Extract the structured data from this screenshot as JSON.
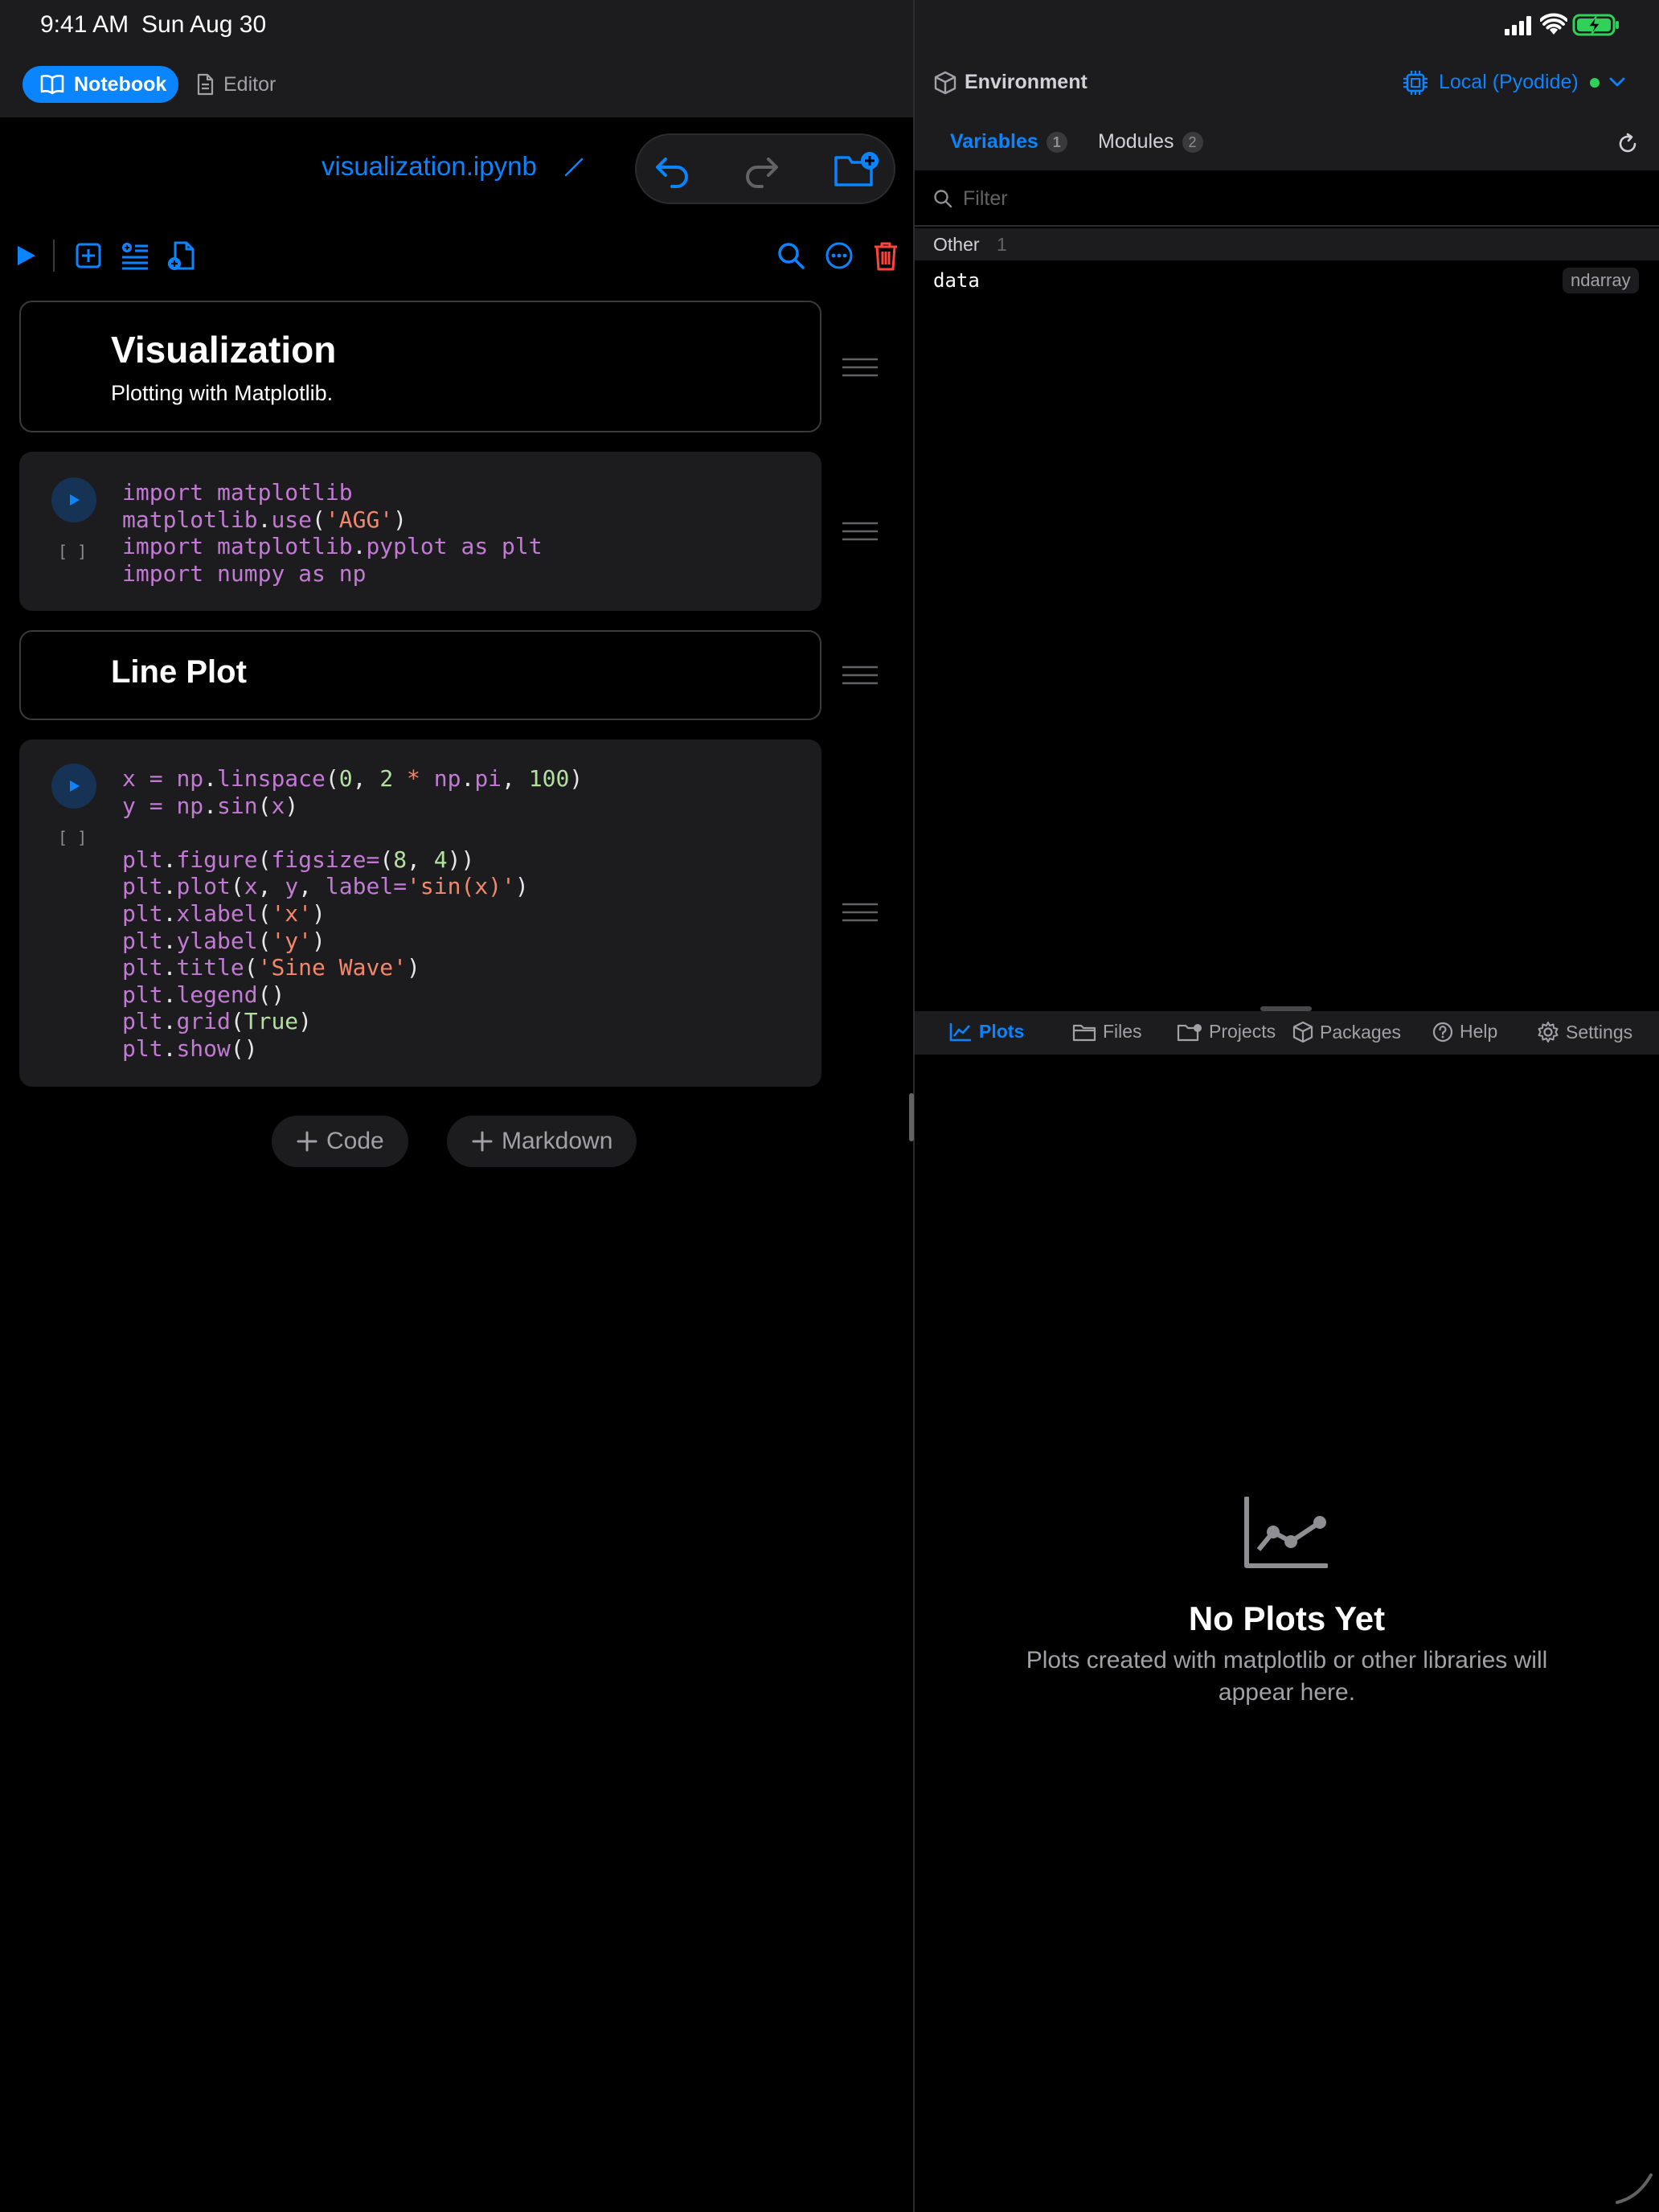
{
  "status_bar": {
    "time": "9:41 AM",
    "date": "Sun Aug 30"
  },
  "left_header": {
    "notebook_label": "Notebook",
    "editor_label": "Editor"
  },
  "notebook": {
    "filename": "visualization.ipynb"
  },
  "cells": [
    {
      "type": "markdown",
      "heading": "Visualization",
      "text": "Plotting with Matplotlib."
    },
    {
      "type": "code",
      "exec_count": "[ ]"
    },
    {
      "type": "markdown",
      "heading": "Line Plot"
    },
    {
      "type": "code",
      "exec_count": "[ ]"
    }
  ],
  "add_buttons": {
    "code": "Code",
    "markdown": "Markdown"
  },
  "environment": {
    "title": "Environment",
    "kernel": "Local (Pyodide)",
    "kernel_status_color": "#30d158",
    "tabs": [
      {
        "label": "Variables",
        "count": "1"
      },
      {
        "label": "Modules",
        "count": "2"
      }
    ],
    "filter_placeholder": "Filter",
    "group": {
      "label": "Other",
      "count": "1"
    },
    "variables": [
      {
        "name": "data",
        "type": "ndarray"
      }
    ]
  },
  "bottom_tabs": [
    "Plots",
    "Files",
    "Projects",
    "Packages",
    "Help",
    "Settings"
  ],
  "plots_empty": {
    "title": "No Plots Yet",
    "subtitle": "Plots created with matplotlib or other libraries will appear here."
  },
  "colors": {
    "accent": "#0a84ff",
    "danger": "#ff453a",
    "background": "#000000",
    "panel": "#1c1c1e"
  }
}
